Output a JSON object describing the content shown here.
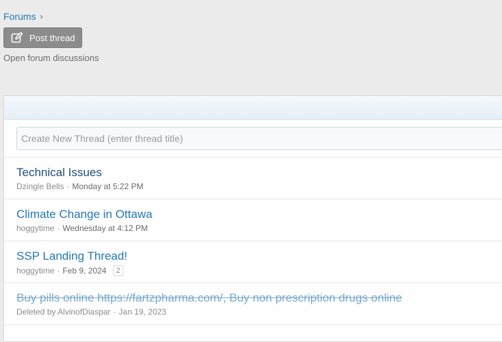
{
  "breadcrumb": {
    "items": [
      "Forums"
    ],
    "separator": "›"
  },
  "toolbar": {
    "post_thread_label": "Post thread",
    "post_thread_icon": "compose-icon"
  },
  "forum": {
    "description": "Open forum discussions"
  },
  "new_thread": {
    "placeholder": "Create New Thread (enter thread title)"
  },
  "threads": [
    {
      "title": "Technical Issues",
      "author": "Dzingle Bells",
      "date": "Monday at 5:22 PM",
      "pages": "",
      "state": "unread"
    },
    {
      "title": "Climate Change in Ottawa",
      "author": "hoggytime",
      "date": "Wednesday at 4:12 PM",
      "pages": "",
      "state": "read"
    },
    {
      "title": "SSP Landing Thread!",
      "author": "hoggytime",
      "date": "Feb 9, 2024",
      "pages": "2",
      "state": "read"
    },
    {
      "title": "Buy pills online https://fartzpharma.com/, Buy non prescription drugs online",
      "author": "Deleted by AlvinofDiaspar",
      "date": "Jan 19, 2023",
      "pages": "",
      "state": "deleted"
    }
  ],
  "colors": {
    "link": "#2577b1",
    "button_bg": "#8c8c8c",
    "page_bg": "#ebebeb"
  }
}
